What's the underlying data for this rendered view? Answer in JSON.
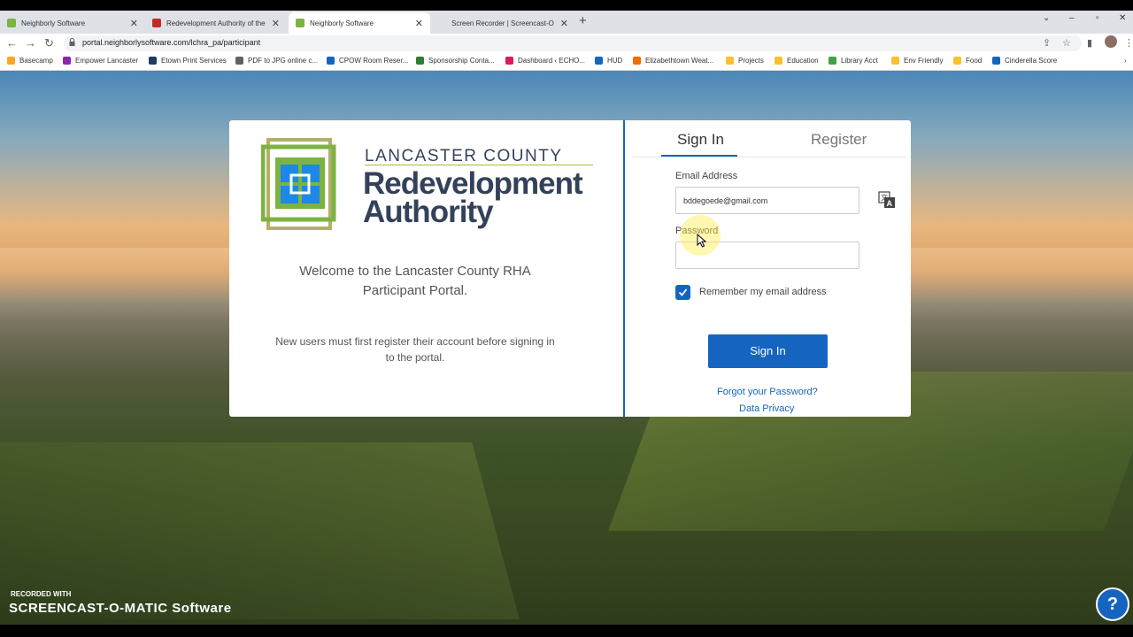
{
  "browser": {
    "tabs": [
      {
        "label": "Neighborly Software",
        "favicon_color": "#7cb342",
        "active": false
      },
      {
        "label": "Redevelopment Authority of the",
        "favicon_color": "#c62828",
        "active": false
      },
      {
        "label": "Neighborly Software",
        "favicon_color": "#7cb342",
        "active": true
      },
      {
        "label": "Screen Recorder | Screencast-O",
        "favicon_color": "#1e88e5",
        "active": false
      }
    ],
    "new_tab": "+",
    "url": "portal.neighborlysoftware.com/lchra_pa/participant",
    "bookmarks": [
      {
        "label": "Basecamp",
        "color": "#f9a825"
      },
      {
        "label": "Empower Lancaster",
        "color": "#8e24aa"
      },
      {
        "label": "Etown Print Services",
        "color": "#1e3a5f"
      },
      {
        "label": "PDF to JPG online c...",
        "color": "#616161"
      },
      {
        "label": "CPOW Room Reser...",
        "color": "#1565c0"
      },
      {
        "label": "Sponsorship Conta...",
        "color": "#2e7d32"
      },
      {
        "label": "Dashboard ‹ ECHO...",
        "color": "#d81b60"
      },
      {
        "label": "HUD",
        "color": "#1565c0"
      },
      {
        "label": "Elizabethtown Weat...",
        "color": "#ef6c00"
      },
      {
        "label": "Projects",
        "color": "#fbc02d"
      },
      {
        "label": "Education",
        "color": "#fbc02d"
      },
      {
        "label": "Library Acct",
        "color": "#43a047"
      },
      {
        "label": "Env Friendly",
        "color": "#fbc02d"
      },
      {
        "label": "Food",
        "color": "#fbc02d"
      },
      {
        "label": "Cinderella Score",
        "color": "#1565c0"
      }
    ]
  },
  "org": {
    "line1": "LANCASTER COUNTY",
    "line2": "Redevelopment",
    "line3": "Authority"
  },
  "left_panel": {
    "welcome": "Welcome to the Lancaster County RHA Participant Portal.",
    "note": "New users must first register their account before signing in to the portal."
  },
  "login": {
    "tab_signin": "Sign In",
    "tab_register": "Register",
    "email_label": "Email Address",
    "email_value": "bddegoede@gmail.com",
    "password_label": "Password",
    "password_value": "",
    "remember_label": "Remember my email address",
    "remember_checked": true,
    "submit_label": "Sign In",
    "forgot_link": "Forgot your Password?",
    "privacy_link": "Data Privacy"
  },
  "watermark": {
    "line1": "RECORDED WITH",
    "line2": "SCREENCAST-O-MATIC Software"
  },
  "help_button": "?",
  "colors": {
    "accent": "#1565c0",
    "logo_green": "#7cb342",
    "logo_blue": "#1e88e5",
    "logo_olive": "#b5ae6a",
    "text_dark": "#34415a"
  }
}
